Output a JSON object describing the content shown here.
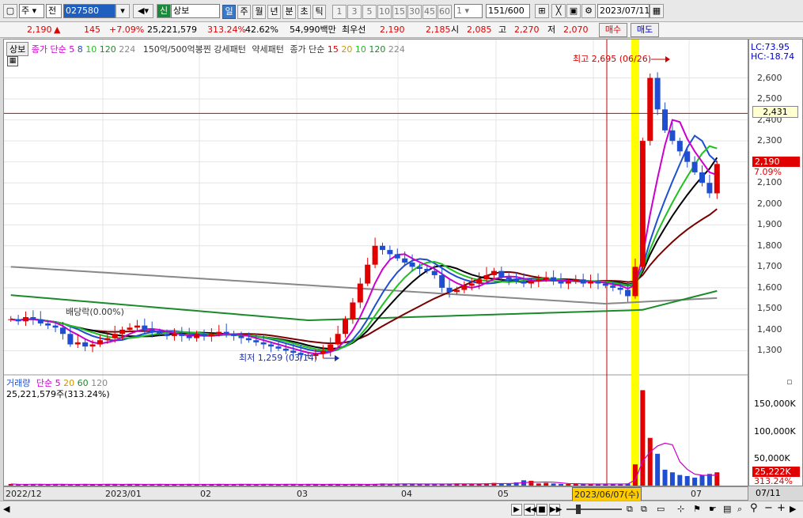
{
  "toolbar": {
    "market": "주",
    "jeon": "전",
    "code": "027580",
    "stock_name": "상보",
    "sin_badge": "신",
    "periods": [
      "일",
      "주",
      "월",
      "년",
      "분",
      "초",
      "틱"
    ],
    "nums": [
      "1",
      "3",
      "5",
      "10",
      "15",
      "30",
      "45",
      "60"
    ],
    "unit_value": "1",
    "count": "151",
    "count_total": "/600",
    "date": "2023/07/11"
  },
  "quote": {
    "price": "2,190",
    "arrow": "▲",
    "change": "145",
    "change_pct": "+7.09%",
    "volume": "25,221,579",
    "volume_ratio": "313.24%",
    "turnover": "42.62%",
    "amount": "54,990백만",
    "label_best": "최우선",
    "best_ask": "2,190",
    "best_bid": "2,185",
    "label_open": "시",
    "open": "2,085",
    "label_high": "고",
    "high": "2,270",
    "label_low": "저",
    "low": "2,070",
    "buy_label": "매수",
    "sell_label": "매도"
  },
  "legend": {
    "name_tag": "상보",
    "ma_title": "종가 단순",
    "ma_periods": [
      "5",
      "8",
      "10",
      "120",
      "224"
    ],
    "pattern_text": "150억/500억봉찐 강세패턴",
    "weak_pattern": "약세패턴",
    "ma2_title": "종가 단순",
    "ma2_periods": [
      "15",
      "20",
      "10",
      "120",
      "224"
    ],
    "dividend": "배당락(0.00%)",
    "high_label": "최고 2,695 (06/26)",
    "low_label": "최저 1,259 (03/14)"
  },
  "volume_legend": {
    "title": "거래량",
    "ma_title": "단순",
    "periods": [
      "5",
      "20",
      "60",
      "120"
    ],
    "value": "25,221,579주(313.24%)"
  },
  "yaxis": {
    "lc": "LC:73.95",
    "hc": "HC:-18.74",
    "price_ticks": [
      "2,600",
      "2,500",
      "2,400",
      "2,300",
      "2,200",
      "2,100",
      "2,000",
      "1,900",
      "1,800",
      "1,700",
      "1,600",
      "1,500",
      "1,400",
      "1,300"
    ],
    "crosshair_price": "2,431",
    "current_price": "2,190",
    "current_pct": "7.09%",
    "vol_ticks": [
      "150,000K",
      "100,000K",
      "50,000K"
    ],
    "current_vol": "25,222K",
    "current_vol_pct": "313.24%"
  },
  "xaxis": {
    "labels": [
      "2022/12",
      "2023/01",
      "02",
      "03",
      "04",
      "05",
      "07"
    ],
    "cursor_date": "2023/06/07(수)",
    "right_date": "07/11"
  },
  "colors": {
    "up": "#e00000",
    "down": "#1f4fd0",
    "ma5": "#cc00cc",
    "ma8": "#1f4fd0",
    "ma10": "#20c020",
    "ma20": "#000000",
    "ma120": "#7a0000",
    "ma224": "#1a8a2a",
    "ma_long": "#888888",
    "highlight": "#ffff00"
  },
  "chart_data": {
    "type": "candlestick",
    "y_range": [
      1200,
      2700
    ],
    "closes": [
      1450,
      1440,
      1460,
      1450,
      1430,
      1420,
      1410,
      1380,
      1330,
      1340,
      1320,
      1330,
      1350,
      1360,
      1380,
      1400,
      1410,
      1420,
      1400,
      1390,
      1380,
      1370,
      1380,
      1370,
      1360,
      1380,
      1370,
      1380,
      1390,
      1380,
      1370,
      1360,
      1350,
      1340,
      1330,
      1320,
      1310,
      1300,
      1290,
      1280,
      1275,
      1285,
      1300,
      1330,
      1380,
      1450,
      1530,
      1620,
      1710,
      1800,
      1780,
      1760,
      1740,
      1720,
      1700,
      1690,
      1680,
      1660,
      1600,
      1580,
      1590,
      1610,
      1620,
      1640,
      1660,
      1680,
      1650,
      1640,
      1630,
      1620,
      1630,
      1640,
      1650,
      1630,
      1620,
      1630,
      1640,
      1620,
      1630,
      1620,
      1610,
      1600,
      1590,
      1560,
      1700,
      2300,
      2600,
      2450,
      2350,
      2300,
      2250,
      2200,
      2150,
      2100,
      2050,
      2190
    ],
    "volumes_k": [
      3,
      2,
      2,
      3,
      2,
      2,
      3,
      2,
      2,
      2,
      3,
      2,
      2,
      3,
      2,
      2,
      3,
      2,
      2,
      2,
      3,
      2,
      2,
      2,
      3,
      2,
      2,
      2,
      3,
      2,
      2,
      3,
      2,
      2,
      3,
      2,
      2,
      3,
      2,
      2,
      3,
      2,
      2,
      3,
      2,
      2,
      3,
      2,
      2,
      3,
      4,
      3,
      3,
      3,
      3,
      3,
      3,
      3,
      3,
      3,
      4,
      3,
      3,
      3,
      4,
      5,
      4,
      3,
      6,
      10,
      9,
      4,
      5,
      4,
      3,
      3,
      3,
      3,
      3,
      3,
      3,
      3,
      3,
      4,
      40,
      180,
      90,
      60,
      30,
      25,
      20,
      18,
      15,
      20,
      22,
      25
    ]
  }
}
